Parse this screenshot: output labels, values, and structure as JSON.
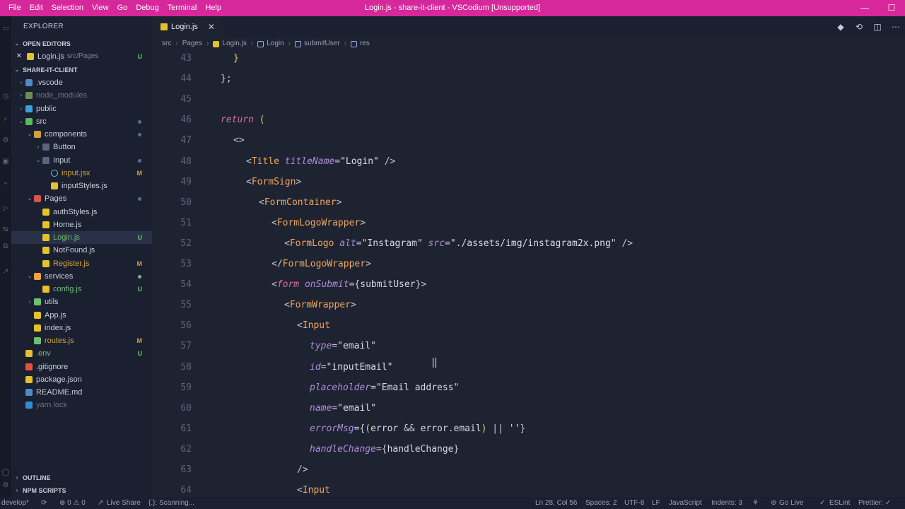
{
  "titlebar": {
    "menu": [
      "File",
      "Edit",
      "Selection",
      "View",
      "Go",
      "Debug",
      "Terminal",
      "Help"
    ],
    "title": "Login.js - share-it-client - VSCodium [Unsupported]",
    "minimize": "—",
    "maximize": "☐"
  },
  "sidebar": {
    "header": "EXPLORER",
    "open_editors_label": "OPEN EDITORS",
    "open_editor": {
      "close": "✕",
      "name": "Login.js",
      "path": "src/Pages",
      "badge": "U"
    },
    "project_label": "SHARE-IT-CLIENT",
    "tree": [
      {
        "label": ".vscode",
        "kind": "folder",
        "color": "#4f8ac9",
        "indent": 1,
        "chev": "›"
      },
      {
        "label": "node_modules",
        "kind": "folder",
        "color": "#6b8f4e",
        "indent": 1,
        "chev": "›",
        "dim": true
      },
      {
        "label": "public",
        "kind": "folder",
        "color": "#3aa0d9",
        "indent": 1,
        "chev": "›"
      },
      {
        "label": "src",
        "kind": "folder",
        "color": "#5bb85d",
        "indent": 1,
        "chev": "⌄",
        "dot": true
      },
      {
        "label": "components",
        "kind": "folder",
        "color": "#d1a23b",
        "indent": 2,
        "chev": "⌄",
        "dot": true
      },
      {
        "label": "Button",
        "kind": "folder",
        "color": "#5a6380",
        "indent": 3,
        "chev": "›"
      },
      {
        "label": "Input",
        "kind": "folder",
        "color": "#5a6380",
        "indent": 3,
        "chev": "⌄",
        "dot": true
      },
      {
        "label": "input.jsx",
        "kind": "react",
        "color": "#5ec8e5",
        "indent": 4,
        "badge": "M",
        "badgeColor": "#d1a23b"
      },
      {
        "label": "inputStyles.js",
        "kind": "js",
        "color": "#e3c22b",
        "indent": 4
      },
      {
        "label": "Pages",
        "kind": "folder",
        "color": "#d9534f",
        "indent": 2,
        "chev": "⌄",
        "dot": true
      },
      {
        "label": "authStyles.js",
        "kind": "js",
        "color": "#e3c22b",
        "indent": 3
      },
      {
        "label": "Home.js",
        "kind": "js",
        "color": "#e3c22b",
        "indent": 3
      },
      {
        "label": "Login.js",
        "kind": "js",
        "color": "#e3c22b",
        "indent": 3,
        "badge": "U",
        "badgeColor": "#6fbf73",
        "selected": true
      },
      {
        "label": "NotFound.js",
        "kind": "js",
        "color": "#e3c22b",
        "indent": 3
      },
      {
        "label": "Register.js",
        "kind": "js",
        "color": "#e3c22b",
        "indent": 3,
        "badge": "M",
        "badgeColor": "#d1a23b"
      },
      {
        "label": "services",
        "kind": "folder",
        "color": "#f2a23b",
        "indent": 2,
        "chev": "⌄",
        "dot": true,
        "dotColor": "#6fbf73"
      },
      {
        "label": "config.js",
        "kind": "js",
        "color": "#e3c22b",
        "indent": 3,
        "badge": "U",
        "badgeColor": "#6fbf73"
      },
      {
        "label": "utils",
        "kind": "folder",
        "color": "#6fbf73",
        "indent": 2,
        "chev": "›"
      },
      {
        "label": "App.js",
        "kind": "js",
        "color": "#e3c22b",
        "indent": 2
      },
      {
        "label": "index.js",
        "kind": "js",
        "color": "#e3c22b",
        "indent": 2
      },
      {
        "label": "routes.js",
        "kind": "route",
        "color": "#6fbf73",
        "indent": 2,
        "badge": "M",
        "badgeColor": "#d1a23b"
      },
      {
        "label": ".env",
        "kind": "env",
        "color": "#e3c22b",
        "indent": 1,
        "badge": "U",
        "badgeColor": "#6fbf73"
      },
      {
        "label": ".gitignore",
        "kind": "git",
        "color": "#e5533d",
        "indent": 1
      },
      {
        "label": "package.json",
        "kind": "json",
        "color": "#e3c22b",
        "indent": 1
      },
      {
        "label": "README.md",
        "kind": "md",
        "color": "#4f8ac9",
        "indent": 1
      },
      {
        "label": "yarn.lock",
        "kind": "yarn",
        "color": "#2f8fd1",
        "indent": 1,
        "dim": true
      }
    ],
    "outline_label": "OUTLINE",
    "npm_label": "NPM SCRIPTS"
  },
  "editor": {
    "tab": {
      "name": "Login.js",
      "close": "✕"
    },
    "actions": [
      "◆",
      "⟲",
      "◫",
      "⋯"
    ],
    "breadcrumb": [
      "src",
      "Pages",
      "Login.js",
      "Login",
      "submitUser",
      "res"
    ],
    "lines": [
      {
        "n": "43",
        "indent": 1,
        "toks": [
          [
            "t-br",
            "}"
          ]
        ]
      },
      {
        "n": "44",
        "indent": 0,
        "toks": [
          [
            "t-br",
            "}"
          ],
          [
            "t-punc",
            ";"
          ]
        ]
      },
      {
        "n": "45",
        "indent": 0,
        "toks": []
      },
      {
        "n": "46",
        "indent": 0,
        "toks": [
          [
            "t-kw",
            "return"
          ],
          [
            "t-punc",
            " "
          ],
          [
            "t-br",
            "("
          ]
        ]
      },
      {
        "n": "47",
        "indent": 1,
        "toks": [
          [
            "t-punc",
            "<>"
          ]
        ]
      },
      {
        "n": "48",
        "indent": 2,
        "toks": [
          [
            "t-punc",
            "<"
          ],
          [
            "t-tag",
            "Title"
          ],
          [
            "t-punc",
            " "
          ],
          [
            "t-attr",
            "titleName"
          ],
          [
            "t-punc",
            "="
          ],
          [
            "t-str",
            "\"Login\""
          ],
          [
            "t-punc",
            " />"
          ]
        ]
      },
      {
        "n": "49",
        "indent": 2,
        "toks": [
          [
            "t-punc",
            "<"
          ],
          [
            "t-tag",
            "FormSign"
          ],
          [
            "t-punc",
            ">"
          ]
        ]
      },
      {
        "n": "50",
        "indent": 3,
        "toks": [
          [
            "t-punc",
            "<"
          ],
          [
            "t-tag",
            "FormContainer"
          ],
          [
            "t-punc",
            ">"
          ]
        ]
      },
      {
        "n": "51",
        "indent": 4,
        "toks": [
          [
            "t-punc",
            "<"
          ],
          [
            "t-tag",
            "FormLogoWrapper"
          ],
          [
            "t-punc",
            ">"
          ]
        ]
      },
      {
        "n": "52",
        "indent": 5,
        "toks": [
          [
            "t-punc",
            "<"
          ],
          [
            "t-tag",
            "FormLogo"
          ],
          [
            "t-punc",
            " "
          ],
          [
            "t-attr",
            "alt"
          ],
          [
            "t-punc",
            "="
          ],
          [
            "t-str",
            "\"Instagram\""
          ],
          [
            "t-punc",
            " "
          ],
          [
            "t-attr",
            "src"
          ],
          [
            "t-punc",
            "="
          ],
          [
            "t-str",
            "\"./assets/img/instagram2x.png\""
          ],
          [
            "t-punc",
            " />"
          ]
        ]
      },
      {
        "n": "53",
        "indent": 4,
        "toks": [
          [
            "t-punc",
            "</"
          ],
          [
            "t-tag",
            "FormLogoWrapper"
          ],
          [
            "t-punc",
            ">"
          ]
        ]
      },
      {
        "n": "54",
        "indent": 4,
        "toks": [
          [
            "t-punc",
            "<"
          ],
          [
            "t-kw",
            "form"
          ],
          [
            "t-punc",
            " "
          ],
          [
            "t-attr",
            "onSubmit"
          ],
          [
            "t-punc",
            "="
          ],
          [
            "t-punc",
            "{"
          ],
          [
            "t-var",
            "submitUser"
          ],
          [
            "t-punc",
            "}>"
          ]
        ]
      },
      {
        "n": "55",
        "indent": 5,
        "toks": [
          [
            "t-punc",
            "<"
          ],
          [
            "t-tag",
            "FormWrapper"
          ],
          [
            "t-punc",
            ">"
          ]
        ]
      },
      {
        "n": "56",
        "indent": 6,
        "toks": [
          [
            "t-punc",
            "<"
          ],
          [
            "t-tag",
            "Input"
          ]
        ]
      },
      {
        "n": "57",
        "indent": 7,
        "toks": [
          [
            "t-attr",
            "type"
          ],
          [
            "t-punc",
            "="
          ],
          [
            "t-str",
            "\"email\""
          ]
        ]
      },
      {
        "n": "58",
        "indent": 7,
        "toks": [
          [
            "t-attr",
            "id"
          ],
          [
            "t-punc",
            "="
          ],
          [
            "t-str",
            "\"inputEmail\""
          ]
        ]
      },
      {
        "n": "59",
        "indent": 7,
        "toks": [
          [
            "t-attr",
            "placeholder"
          ],
          [
            "t-punc",
            "="
          ],
          [
            "t-str",
            "\"Email address\""
          ]
        ]
      },
      {
        "n": "60",
        "indent": 7,
        "toks": [
          [
            "t-attr",
            "name"
          ],
          [
            "t-punc",
            "="
          ],
          [
            "t-str",
            "\"email\""
          ]
        ]
      },
      {
        "n": "61",
        "indent": 7,
        "toks": [
          [
            "t-attr",
            "errorMsg"
          ],
          [
            "t-punc",
            "={"
          ],
          [
            "t-br",
            "("
          ],
          [
            "t-var",
            "error"
          ],
          [
            "t-punc",
            " && "
          ],
          [
            "t-var",
            "error.email"
          ],
          [
            "t-br",
            ")"
          ],
          [
            "t-punc",
            " || "
          ],
          [
            "t-str",
            "''"
          ],
          [
            "t-punc",
            "}"
          ]
        ]
      },
      {
        "n": "62",
        "indent": 7,
        "toks": [
          [
            "t-attr",
            "handleChange"
          ],
          [
            "t-punc",
            "={"
          ],
          [
            "t-var",
            "handleChange"
          ],
          [
            "t-punc",
            "}"
          ]
        ]
      },
      {
        "n": "63",
        "indent": 6,
        "toks": [
          [
            "t-punc",
            "/>"
          ]
        ]
      },
      {
        "n": "64",
        "indent": 6,
        "toks": [
          [
            "t-punc",
            "<"
          ],
          [
            "t-tag",
            "Input"
          ]
        ]
      }
    ]
  },
  "statusbar": {
    "branch": "develop*",
    "sync": "⟳",
    "problems": "⊗ 0  ⚠ 0",
    "liveshare": "Live Share",
    "scanning": "{.}: Scanning...",
    "position": "Ln 28, Col 56",
    "spaces": "Spaces: 2",
    "encoding": "UTF-8",
    "eol": "LF",
    "language": "JavaScript",
    "indents": "Indents: 3",
    "golive": "Go Live",
    "eslint": "ESLint",
    "prettier": "Prettier: ✓"
  }
}
